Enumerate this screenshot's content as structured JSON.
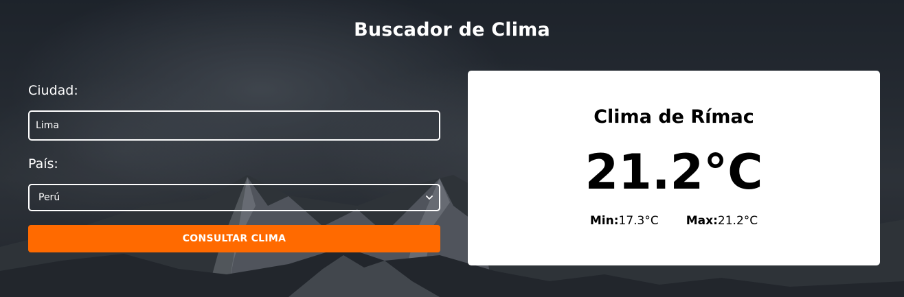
{
  "page": {
    "title": "Buscador de Clima"
  },
  "form": {
    "city_label": "Ciudad:",
    "city_value": "Lima",
    "country_label": "País:",
    "country_selected": "Perú",
    "submit_label": "CONSULTAR CLIMA"
  },
  "result": {
    "title": "Clima de Rímac",
    "temperature": "21.2°C",
    "min_label": "Min:",
    "min_value": "17.3°C",
    "max_label": "Max:",
    "max_value": "21.2°C"
  },
  "icons": {
    "select_chevron": "chevron-down-icon"
  },
  "colors": {
    "accent": "#ff6a00",
    "card_background": "#ffffff",
    "text_light": "#ffffff",
    "text_dark": "#000000"
  }
}
